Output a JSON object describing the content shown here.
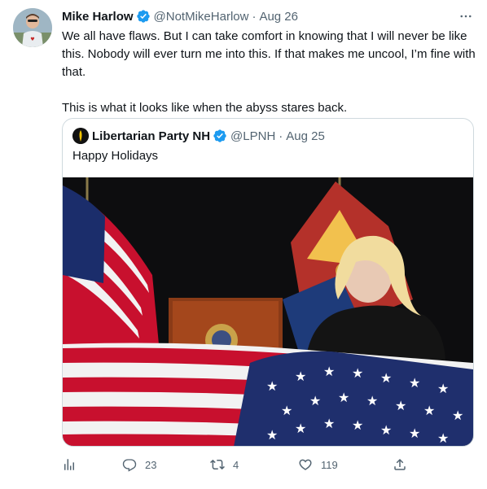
{
  "tweet": {
    "author_name": "Mike Harlow",
    "handle": "@NotMikeHarlow",
    "separator": "·",
    "date": "Aug 26",
    "text_line1": "We all have flaws. But I can take comfort in knowing that I will never be like this. Nobody will ever turn me into this. If that makes me uncool, I’m fine with that.",
    "text_line2": "This is what it looks like when the abyss stares back."
  },
  "quoted_tweet": {
    "author_name": "Libertarian Party NH",
    "handle": "@LPNH",
    "separator": "·",
    "date": "Aug 25",
    "text": "Happy Holidays"
  },
  "actions": {
    "replies": "23",
    "retweets": "4",
    "likes": "119"
  },
  "colors": {
    "verified": "#1d9bf0",
    "secondary_text": "#536471",
    "border": "#cfd9de"
  }
}
